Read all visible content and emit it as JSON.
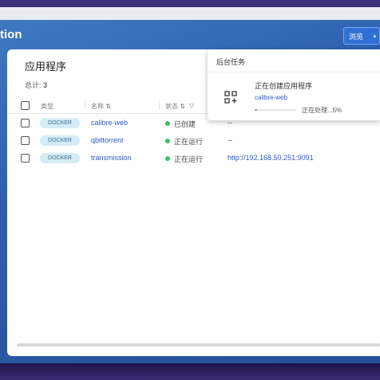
{
  "header": {
    "app_title": "tion",
    "browse_label": "浏览",
    "caret": "▾"
  },
  "panel": {
    "title": "应用程序",
    "total_label": "总计:",
    "total_count": "3",
    "columns": {
      "type": "类型",
      "name": "名称 ⇅",
      "status": "状态 ⇅",
      "filter_icon": "▽"
    }
  },
  "rows": [
    {
      "type": "DOCKER",
      "name": "calibre-web",
      "status": "已创建",
      "status_color": "#3cc06a",
      "port": "--"
    },
    {
      "type": "DOCKER",
      "name": "qbittorrent",
      "status": "正在运行",
      "status_color": "#3cc06a",
      "port": "--"
    },
    {
      "type": "DOCKER",
      "name": "transmission",
      "status": "正在运行",
      "status_color": "#3cc06a",
      "url": "http://192.168.50.251:9091"
    }
  ],
  "tasks": {
    "title": "后台任务",
    "item": {
      "name": "正在创建应用程序",
      "app": "calibre-web",
      "progress_text": "正在处理...5%",
      "progress": 0.05,
      "icon": "apps-add-icon"
    }
  },
  "colors": {
    "accent": "#2f6fd6",
    "link": "#2b5cc8",
    "badge_bg": "#d4ecf6",
    "running": "#3cc06a"
  }
}
